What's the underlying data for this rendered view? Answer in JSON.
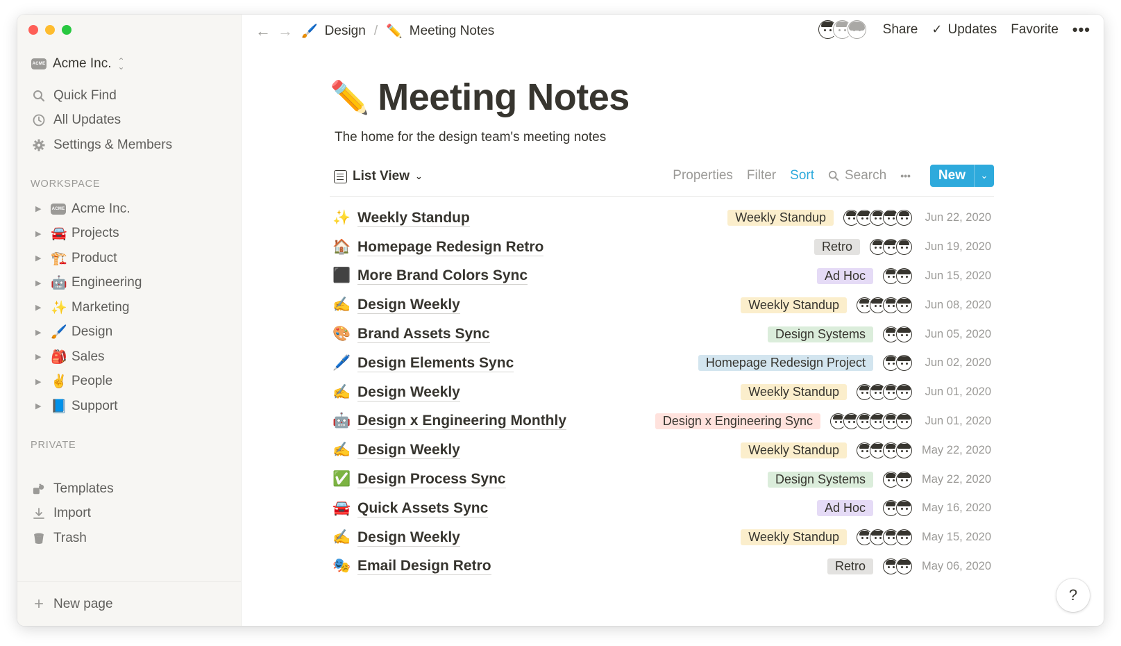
{
  "colors": {
    "accent": "#2eaadc",
    "sidebar_bg": "#f7f6f3",
    "text": "#37352f",
    "muted": "#9b9a97",
    "tag_weekly_standup": "#fbeecc",
    "tag_retro": "#e3e2e0",
    "tag_ad_hoc": "#e5dbf6",
    "tag_design_systems": "#dbeddb",
    "tag_homepage": "#d3e5ef",
    "tag_design_eng": "#ffe2dd"
  },
  "sidebar": {
    "workspace_name": "Acme Inc.",
    "logo_text": "ACME",
    "menu": [
      {
        "label": "Quick Find",
        "icon": "search-icon"
      },
      {
        "label": "All Updates",
        "icon": "clock-icon"
      },
      {
        "label": "Settings & Members",
        "icon": "gear-icon"
      }
    ],
    "workspace_label": "WORKSPACE",
    "pages": [
      {
        "label": "Acme Inc.",
        "emoji": "acme-logo"
      },
      {
        "label": "Projects",
        "emoji": "🚘"
      },
      {
        "label": "Product",
        "emoji": "🏗️"
      },
      {
        "label": "Engineering",
        "emoji": "🤖"
      },
      {
        "label": "Marketing",
        "emoji": "✨"
      },
      {
        "label": "Design",
        "emoji": "🖌️"
      },
      {
        "label": "Sales",
        "emoji": "🎒"
      },
      {
        "label": "People",
        "emoji": "✌️"
      },
      {
        "label": "Support",
        "emoji": "📘"
      }
    ],
    "private_label": "PRIVATE",
    "private_items": [
      {
        "label": "Templates",
        "icon": "templates-icon"
      },
      {
        "label": "Import",
        "icon": "download-icon"
      },
      {
        "label": "Trash",
        "icon": "trash-icon"
      }
    ],
    "new_page": "New page"
  },
  "topbar": {
    "breadcrumb": [
      {
        "label": "Design",
        "emoji": "🖌️"
      },
      {
        "label": "Meeting Notes",
        "emoji": "✏️"
      }
    ],
    "separator": "/",
    "share": "Share",
    "updates": "Updates",
    "favorite": "Favorite",
    "more": "•••"
  },
  "page": {
    "emoji": "✏️",
    "title": "Meeting Notes",
    "description": "The home for the design team's meeting notes"
  },
  "view": {
    "name": "List View",
    "tools": {
      "properties": "Properties",
      "filter": "Filter",
      "sort": "Sort",
      "search": "Search",
      "more": "•••"
    },
    "new_button": "New"
  },
  "rows": [
    {
      "emoji": "✨",
      "title": "Weekly Standup",
      "tag": "Weekly Standup",
      "tag_color": "#fbeecc",
      "faces": 5,
      "date": "Jun 22, 2020"
    },
    {
      "emoji": "🏠",
      "title": "Homepage Redesign Retro",
      "tag": "Retro",
      "tag_color": "#e3e2e0",
      "faces": 3,
      "date": "Jun 19, 2020"
    },
    {
      "emoji": "⬛",
      "title": "More Brand Colors Sync",
      "tag": "Ad Hoc",
      "tag_color": "#e5dbf6",
      "faces": 2,
      "date": "Jun 15, 2020"
    },
    {
      "emoji": "✍️",
      "title": "Design Weekly",
      "tag": "Weekly Standup",
      "tag_color": "#fbeecc",
      "faces": 4,
      "date": "Jun 08, 2020"
    },
    {
      "emoji": "🎨",
      "title": "Brand Assets Sync",
      "tag": "Design Systems",
      "tag_color": "#dbeddb",
      "faces": 2,
      "date": "Jun 05, 2020"
    },
    {
      "emoji": "🖊️",
      "title": "Design Elements Sync",
      "tag": "Homepage Redesign Project",
      "tag_color": "#d3e5ef",
      "faces": 2,
      "date": "Jun 02, 2020"
    },
    {
      "emoji": "✍️",
      "title": "Design Weekly",
      "tag": "Weekly Standup",
      "tag_color": "#fbeecc",
      "faces": 4,
      "date": "Jun 01, 2020"
    },
    {
      "emoji": "🤖",
      "title": "Design x Engineering Monthly",
      "tag": "Design x Engineering Sync",
      "tag_color": "#ffe2dd",
      "faces": 6,
      "date": "Jun 01, 2020"
    },
    {
      "emoji": "✍️",
      "title": "Design Weekly",
      "tag": "Weekly Standup",
      "tag_color": "#fbeecc",
      "faces": 4,
      "date": "May 22, 2020"
    },
    {
      "emoji": "✅",
      "title": "Design Process Sync",
      "tag": "Design Systems",
      "tag_color": "#dbeddb",
      "faces": 2,
      "date": "May 22, 2020"
    },
    {
      "emoji": "🚘",
      "title": "Quick Assets Sync",
      "tag": "Ad Hoc",
      "tag_color": "#e5dbf6",
      "faces": 2,
      "date": "May 16, 2020"
    },
    {
      "emoji": "✍️",
      "title": "Design Weekly",
      "tag": "Weekly Standup",
      "tag_color": "#fbeecc",
      "faces": 4,
      "date": "May 15, 2020"
    },
    {
      "emoji": "🎭",
      "title": "Email Design Retro",
      "tag": "Retro",
      "tag_color": "#e3e2e0",
      "faces": 2,
      "date": "May 06, 2020"
    }
  ],
  "help": "?"
}
